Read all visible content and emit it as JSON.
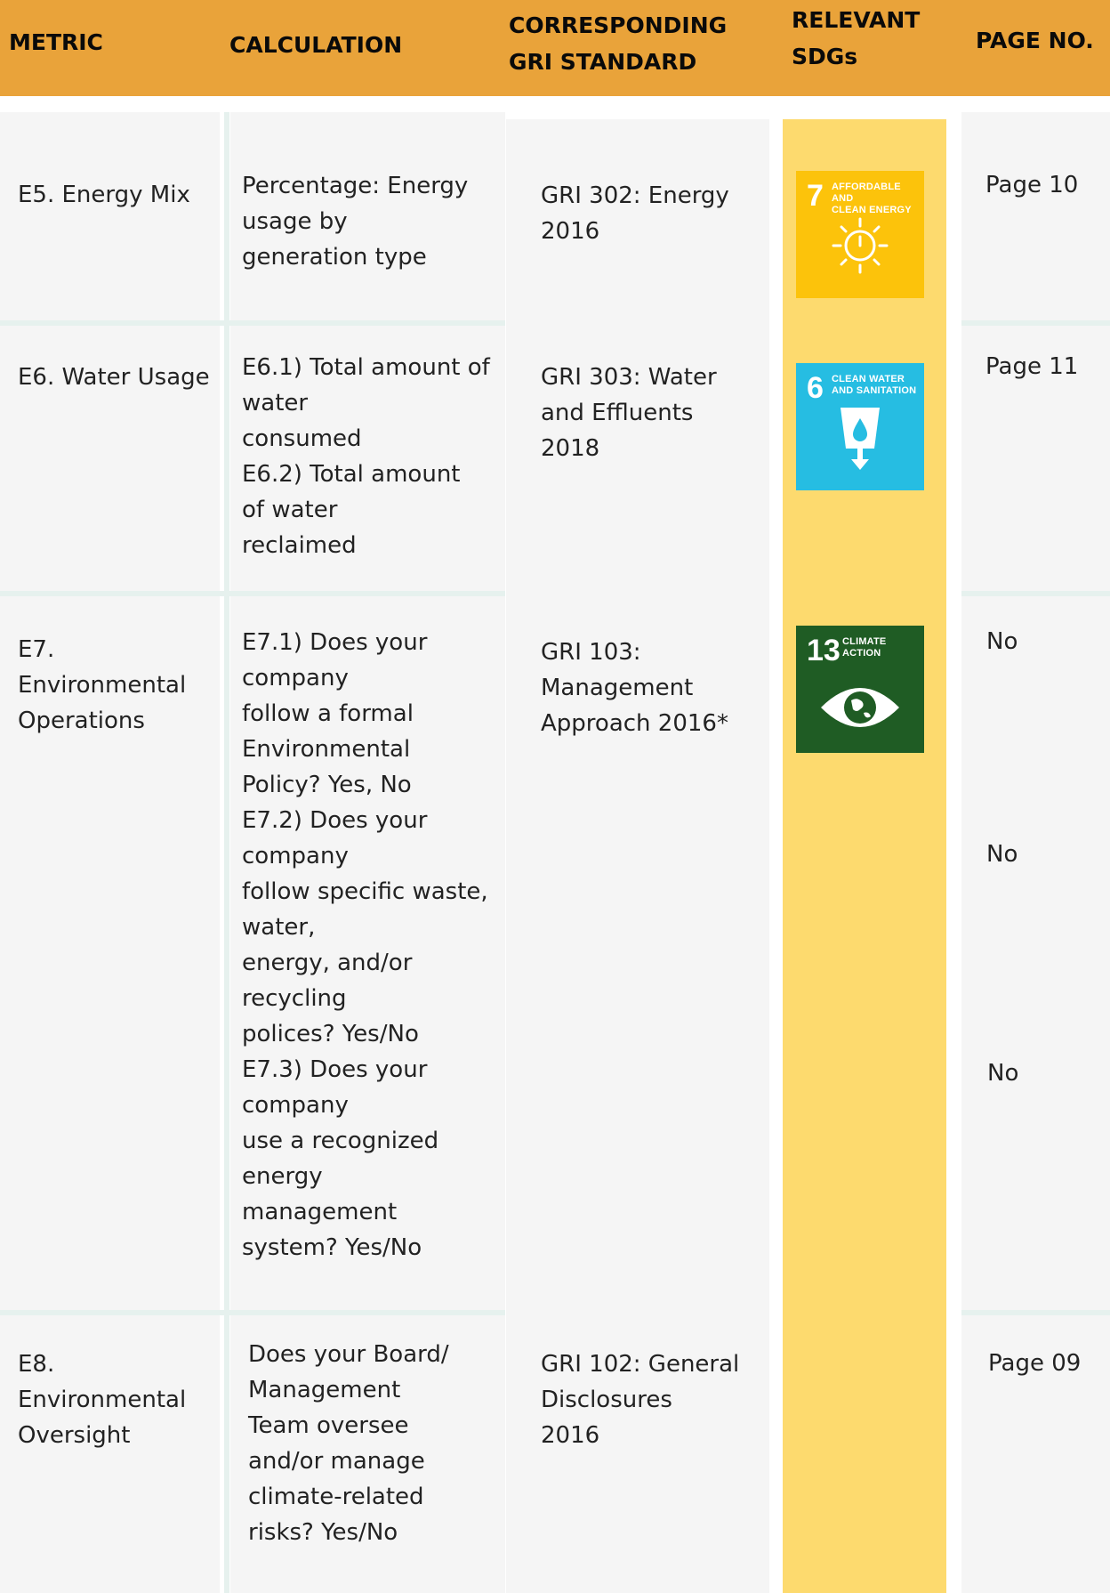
{
  "header": {
    "metric": "METRIC",
    "calculation": "CALCULATION",
    "gri": "CORRESPONDING\nGRI STANDARD",
    "sdgs": "RELEVANT\nSDGs",
    "page": "PAGE NO."
  },
  "rows": [
    {
      "metric": "E5. Energy Mix",
      "calculation": "Percentage: Energy\nusage by\ngeneration type",
      "gri": "GRI 302: Energy\n2016",
      "page": "Page 10",
      "sdg": {
        "number": "7",
        "label": "AFFORDABLE AND\nCLEAN ENERGY",
        "color": "#FCC30B",
        "icon": "sun-power-icon"
      }
    },
    {
      "metric": "E6. Water Usage",
      "calculation": "E6.1) Total amount of\nwater\nconsumed\nE6.2) Total amount\nof water\nreclaimed",
      "gri": "GRI 303: Water\nand Effluents\n2018",
      "page": "Page 11",
      "sdg": {
        "number": "6",
        "label": "CLEAN WATER\nAND SANITATION",
        "color": "#26BDE2",
        "icon": "water-glass-icon"
      }
    },
    {
      "metric": "E7.\nEnvironmental\nOperations",
      "calculation": "E7.1) Does your\ncompany\nfollow a formal\nEnvironmental\nPolicy? Yes, No\nE7.2) Does your\ncompany\nfollow specific waste,\nwater,\nenergy, and/or\nrecycling\npolices? Yes/No\nE7.3) Does your\ncompany\nuse a recognized\nenergy\nmanagement\nsystem? Yes/No",
      "gri": "GRI 103:\nManagement\nApproach 2016*",
      "pages": [
        "No",
        "No",
        "No"
      ],
      "sdg": {
        "number": "13",
        "label": "CLIMATE\nACTION",
        "color": "#1F5C24",
        "icon": "earth-eye-icon"
      }
    },
    {
      "metric": "E8.\nEnvironmental\nOversight",
      "calculation": "Does your Board/\nManagement\nTeam oversee\nand/or manage\nclimate-related\nrisks? Yes/No",
      "gri": "GRI 102: General\nDisclosures\n2016",
      "page": "Page 09"
    }
  ],
  "colors": {
    "header": "#E9A33A",
    "sdg_column": "#FDDA6E",
    "cell_bg": "#F5F5F5",
    "separator": "#E6F1EE"
  }
}
